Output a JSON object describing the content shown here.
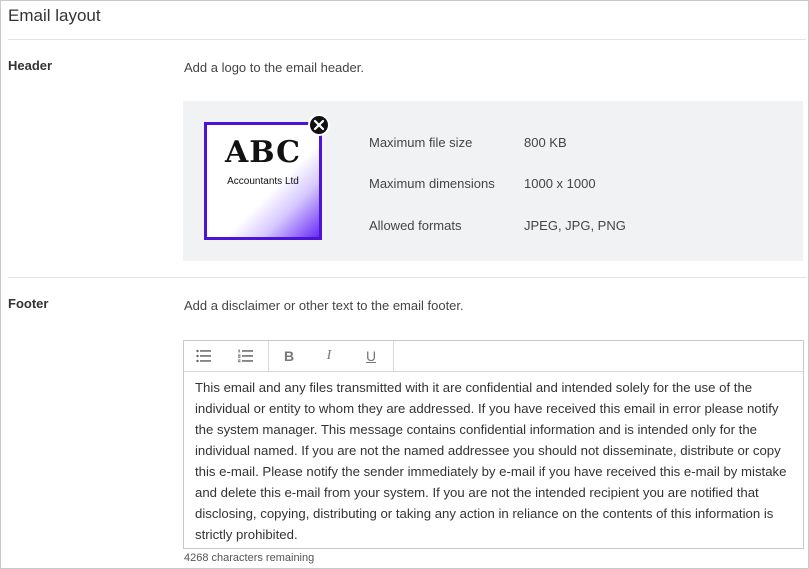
{
  "page": {
    "title": "Email layout"
  },
  "header_section": {
    "label": "Header",
    "help_text": "Add a logo to the email header.",
    "logo": {
      "line1": "ABC",
      "line2": "Accountants Ltd",
      "remove_icon": "close-icon"
    },
    "info": [
      {
        "label": "Maximum file size",
        "value": "800 KB"
      },
      {
        "label": "Maximum dimensions",
        "value": "1000 x 1000"
      },
      {
        "label": "Allowed formats",
        "value": "JPEG, JPG, PNG"
      }
    ]
  },
  "footer_section": {
    "label": "Footer",
    "help_text": "Add a disclaimer or other text to the email footer.",
    "toolbar": {
      "bullet_list_icon": "bullet-list-icon",
      "numbered_list_icon": "numbered-list-icon",
      "bold": "B",
      "italic": "I",
      "underline": "U"
    },
    "content": "This email and any files transmitted with it are confidential and intended solely for the use of the individual or entity to whom they are addressed. If you have received this email in error please notify the system manager. This message contains confidential information and is intended only for the individual named. If you are not the named addressee you should not disseminate, distribute or copy this e-mail. Please notify the sender immediately by e-mail if you have received this e-mail by mistake and delete this e-mail from your system. If you are not the intended recipient you are notified that disclosing, copying, distributing or taking any action in reliance on the contents of this information is strictly prohibited.",
    "chars_remaining": "4268 characters remaining"
  },
  "colors": {
    "logo_border": "#4b14d8",
    "panel_bg": "#f1f2f3"
  }
}
